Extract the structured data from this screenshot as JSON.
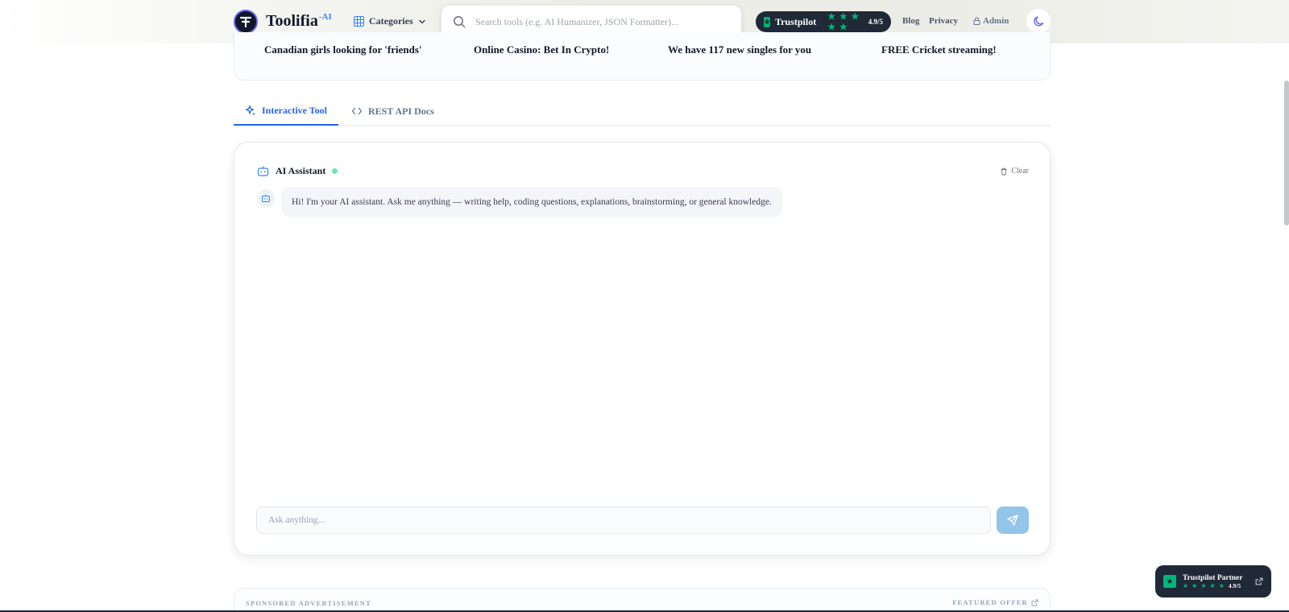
{
  "header": {
    "logo_glyph": "T",
    "logo_name": "Toolifia",
    "logo_suffix": "-AI",
    "categories_label": "Categories",
    "search_placeholder": "Search tools (e.g. AI Humanizer, JSON Formatter)...",
    "trustpilot": {
      "label": "Trustpilot",
      "stars": "★ ★ ★ ★ ★",
      "score": "4.9/5"
    },
    "nav": {
      "blog": "Blog",
      "privacy": "Privacy",
      "admin": "Admin"
    }
  },
  "ad_strip": {
    "items": [
      "Canadian girls looking for 'friends'",
      "Online Casino: Bet In Crypto!",
      "We have 117 new singles for you",
      "FREE Cricket streaming!"
    ]
  },
  "tabs": {
    "interactive": "Interactive Tool",
    "api_docs": "REST API Docs"
  },
  "chat": {
    "title": "AI Assistant",
    "clear_label": "Clear",
    "welcome_message": "Hi! I'm your AI assistant. Ask me anything — writing help, coding questions, explanations, brainstorming, or general knowledge.",
    "input_placeholder": "Ask anything..."
  },
  "bottom_ad": {
    "left_label": "SPONSORED ADVERTISEMENT",
    "right_label": "FEATURED OFFER"
  },
  "partner_card": {
    "title": "Trustpilot Partner",
    "stars": "★ ★ ★ ★ ★",
    "score": "4.9/5"
  },
  "colors": {
    "accent": "#2563eb",
    "trustpilot_green": "#00b67a",
    "dark_pill": "#1f2937",
    "send_button": "#93c5e9",
    "online_dot": "#6ee7b7"
  },
  "icons": {
    "logo": "logo-mark-icon",
    "categories": "grid-icon",
    "chevron": "chevron-down-icon",
    "search": "search-icon",
    "lock": "lock-icon",
    "theme": "moon-icon",
    "sparkle": "sparkle-icon",
    "code": "code-icon",
    "bot": "bot-icon",
    "trash": "trash-icon",
    "send": "send-icon",
    "external": "external-link-icon"
  }
}
